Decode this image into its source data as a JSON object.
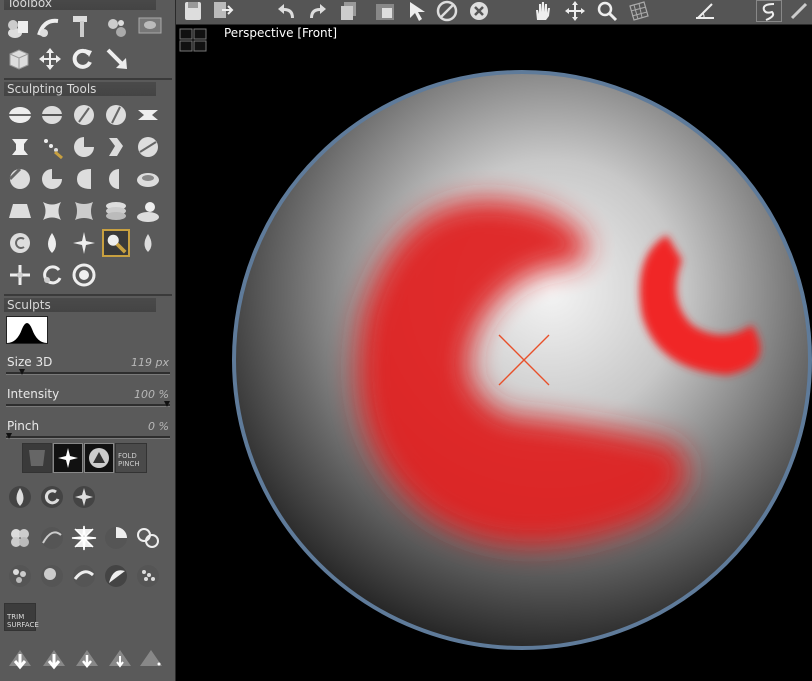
{
  "panel": {
    "toolbox_title": "Toolbox",
    "sculpting_title": "Sculpting Tools",
    "sculpts_title": "Sculpts",
    "trim_label_line1": "TRIM",
    "trim_label_line2": "SURFACE",
    "fold_label_line1": "FOLD",
    "fold_label_line2": "PINCH"
  },
  "sliders": {
    "size": {
      "label": "Size 3D",
      "value": "119 px",
      "fraction": 0.1
    },
    "intensity": {
      "label": "Intensity",
      "value": "100 %",
      "fraction": 1.0
    },
    "pinch": {
      "label": "Pinch",
      "value": "0 %",
      "fraction": 0.0
    }
  },
  "viewport": {
    "label": "Perspective [Front]"
  },
  "colors": {
    "panel_bg": "#5a5a5a",
    "viewport_bg": "#000000",
    "sphere_rim": "#5f7b9a",
    "paint_red": "#e02020",
    "cursor": "#e8502a",
    "selected_tool_border": "#c8a040"
  },
  "icons": {
    "toolbar": [
      "save-icon",
      "export-icon",
      "undo-icon",
      "redo-icon",
      "layers-icon",
      "object-icon",
      "select-arrow-icon",
      "no-icon",
      "close-circle-icon",
      "pan-hand-icon",
      "move-icon",
      "zoom-icon",
      "grid-icon",
      "angle-icon",
      "lasso-icon"
    ]
  }
}
